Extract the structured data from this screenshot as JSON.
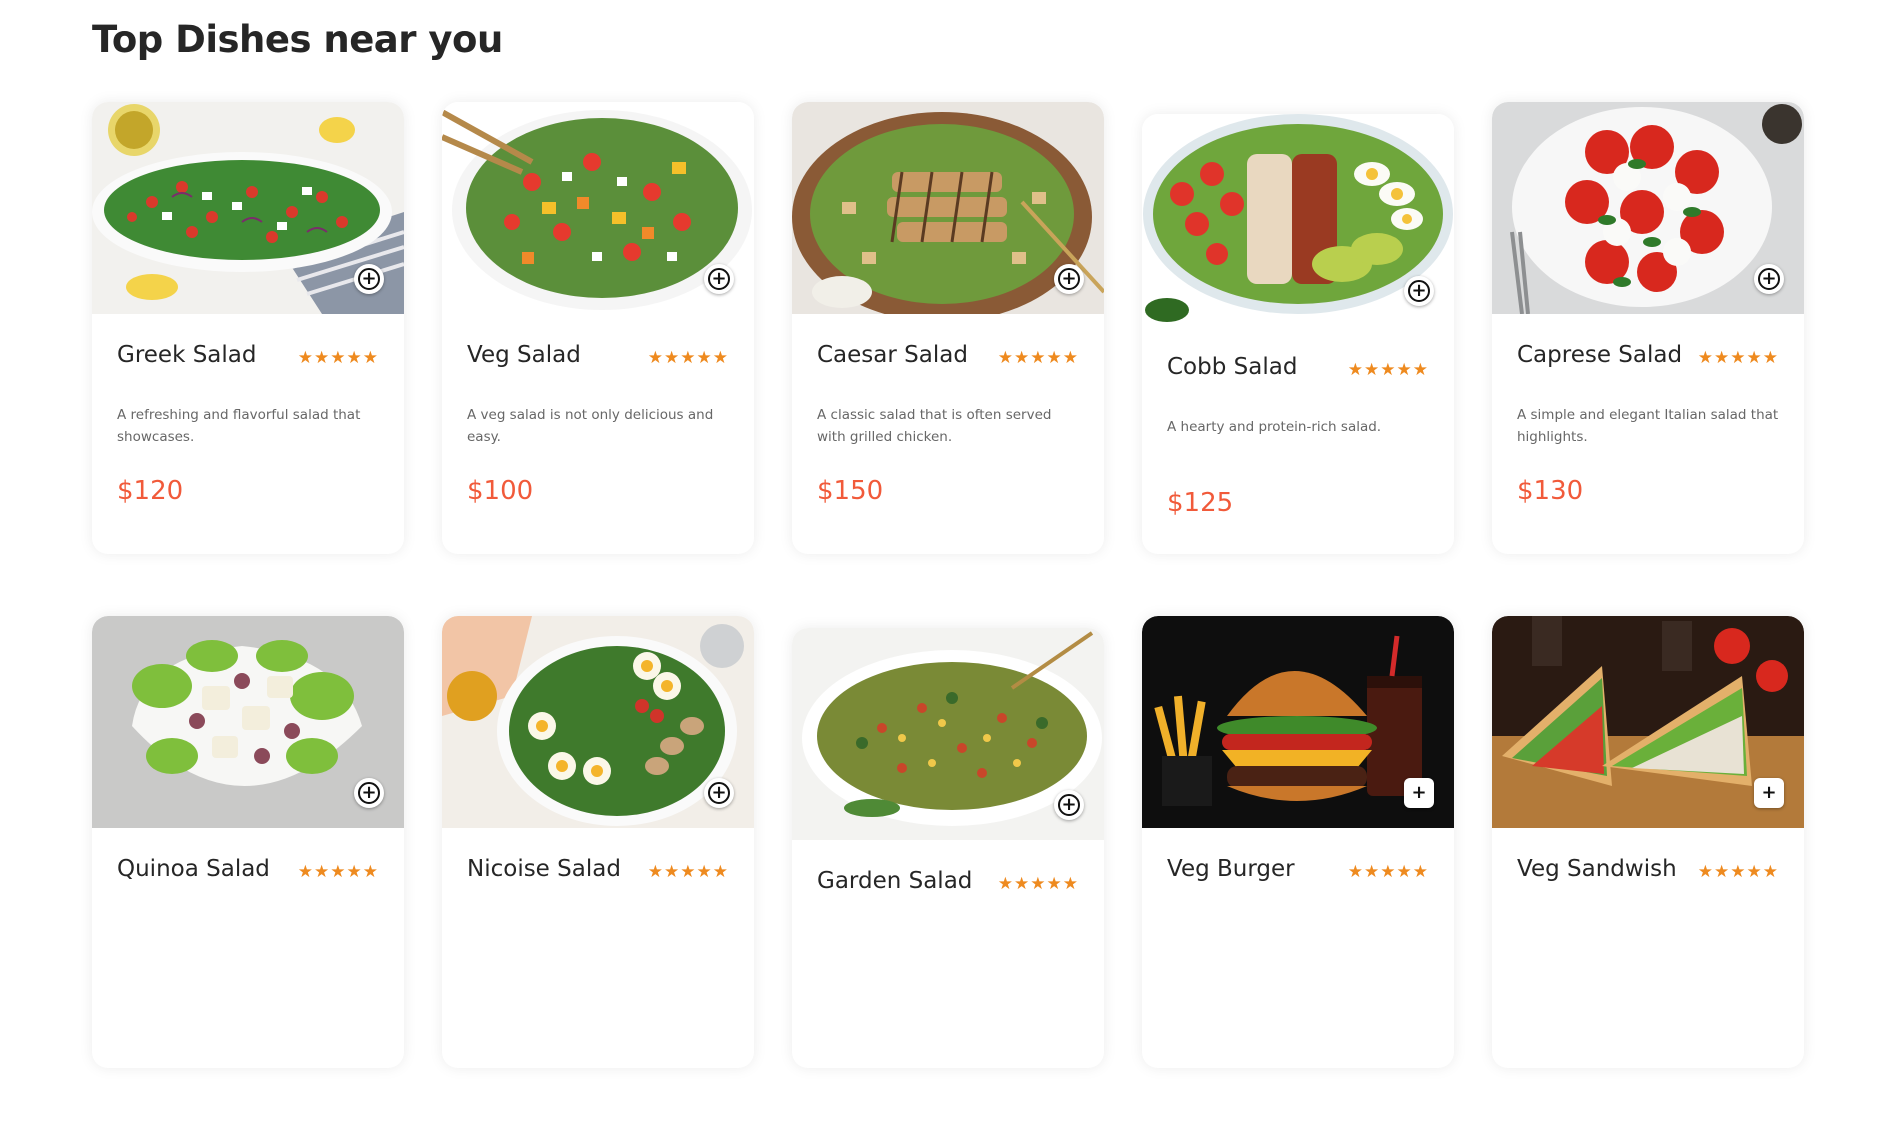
{
  "page": {
    "title": "Top Dishes near you"
  },
  "rating_icon": "star-icon",
  "colors": {
    "accent_price": "#f15a3a",
    "star": "#ee8a1f",
    "title": "#262626"
  },
  "dishes": [
    {
      "name": "Greek Salad",
      "stars": "★★★★★",
      "description": "A refreshing and flavorful salad that showcases.",
      "price": "$120"
    },
    {
      "name": "Veg Salad",
      "stars": "★★★★★",
      "description": "A veg salad is not only delicious and easy.",
      "price": "$100"
    },
    {
      "name": "Caesar Salad",
      "stars": "★★★★★",
      "description": "A classic salad that is often served with grilled chicken.",
      "price": "$150"
    },
    {
      "name": "Cobb Salad",
      "stars": "★★★★★",
      "description": "A hearty and protein-rich salad.",
      "price": "$125"
    },
    {
      "name": "Caprese Salad",
      "stars": "★★★★★",
      "description": "A simple and elegant Italian salad that highlights.",
      "price": "$130"
    },
    {
      "name": "Quinoa Salad",
      "stars": "★★★★★",
      "description": "",
      "price": ""
    },
    {
      "name": "Nicoise Salad",
      "stars": "★★★★★",
      "description": "",
      "price": ""
    },
    {
      "name": "Garden Salad",
      "stars": "★★★★★",
      "description": "",
      "price": ""
    },
    {
      "name": "Veg Burger",
      "stars": "★★★★★",
      "description": "",
      "price": ""
    },
    {
      "name": "Veg Sandwish",
      "stars": "★★★★★",
      "description": "",
      "price": ""
    }
  ],
  "add_button": {
    "symbol": "+",
    "icon": "plus-circle-icon"
  }
}
